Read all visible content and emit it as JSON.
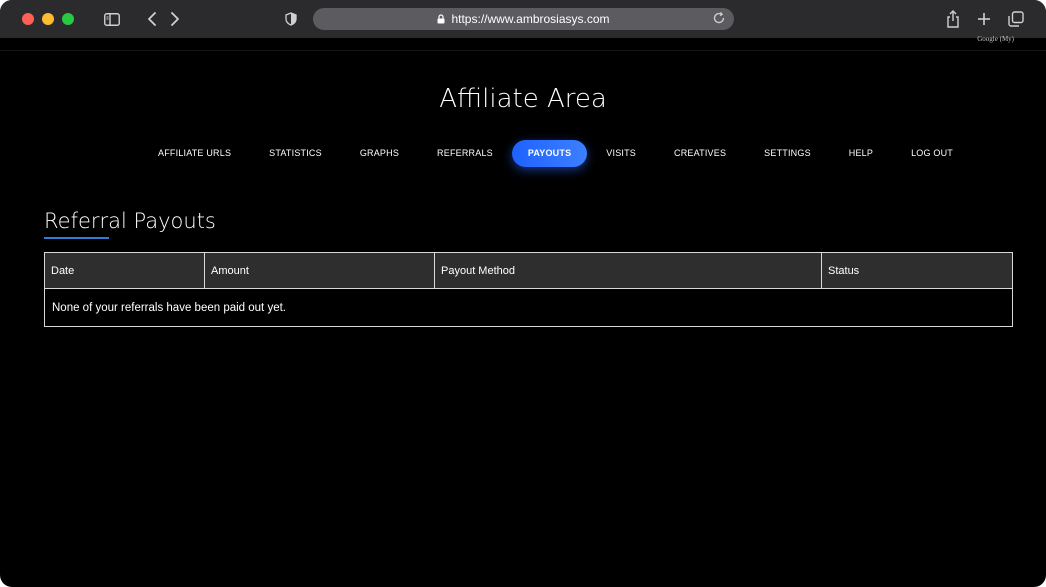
{
  "browser": {
    "url": "https://www.ambrosiasys.com",
    "translate_badge": "Google (My)"
  },
  "page": {
    "title": "Affiliate Area"
  },
  "nav": {
    "items": [
      {
        "label": "AFFILIATE URLS",
        "active": false
      },
      {
        "label": "STATISTICS",
        "active": false
      },
      {
        "label": "GRAPHS",
        "active": false
      },
      {
        "label": "REFERRALS",
        "active": false
      },
      {
        "label": "PAYOUTS",
        "active": true
      },
      {
        "label": "VISITS",
        "active": false
      },
      {
        "label": "CREATIVES",
        "active": false
      },
      {
        "label": "SETTINGS",
        "active": false
      },
      {
        "label": "HELP",
        "active": false
      },
      {
        "label": "LOG OUT",
        "active": false
      }
    ],
    "active_color": "#1e62ff"
  },
  "payouts": {
    "section_title": "Referral Payouts",
    "columns": [
      "Date",
      "Amount",
      "Payout Method",
      "Status"
    ],
    "empty_message": "None of your referrals have been paid out yet."
  }
}
